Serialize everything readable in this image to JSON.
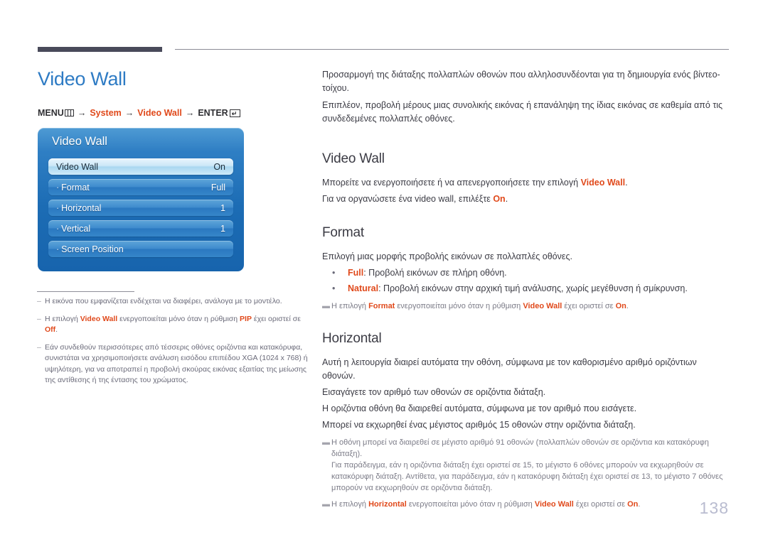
{
  "header": {
    "page_title": "Video Wall",
    "menu_path": {
      "menu_label": "MENU",
      "menu_icon": "menu-bars-icon",
      "arrow": "→",
      "item1": "System",
      "item2": "Video Wall",
      "enter_label": "ENTER",
      "enter_icon": "enter-return-icon",
      "enter_glyph": "↵"
    }
  },
  "osd": {
    "title": "Video Wall",
    "rows": [
      {
        "bullet": "",
        "label": "Video Wall",
        "value": "On",
        "selected": true
      },
      {
        "bullet": "·",
        "label": "Format",
        "value": "Full",
        "selected": false
      },
      {
        "bullet": "·",
        "label": "Horizontal",
        "value": "1",
        "selected": false
      },
      {
        "bullet": "·",
        "label": "Vertical",
        "value": "1",
        "selected": false
      },
      {
        "bullet": "·",
        "label": "Screen Position",
        "value": "",
        "selected": false
      }
    ]
  },
  "left_notes": [
    {
      "dash": "–",
      "parts": [
        {
          "t": "Η εικόνα που εμφανίζεται ενδέχεται να διαφέρει, ανάλογα με το μοντέλο.",
          "hl": false
        }
      ]
    },
    {
      "dash": "–",
      "parts": [
        {
          "t": "Η επιλογή ",
          "hl": false
        },
        {
          "t": "Video Wall",
          "hl": true
        },
        {
          "t": " ενεργοποιείται μόνο όταν η ρύθμιση ",
          "hl": false
        },
        {
          "t": "PIP",
          "hl": true
        },
        {
          "t": " έχει οριστεί σε ",
          "hl": false
        },
        {
          "t": "Off",
          "hl": true
        },
        {
          "t": ".",
          "hl": false
        }
      ]
    },
    {
      "dash": "–",
      "parts": [
        {
          "t": "Εάν συνδεθούν περισσότερες από τέσσερις οθόνες οριζόντια και κατακόρυφα, συνιστάται να χρησιμοποιήσετε ανάλυση εισόδου επιπέδου XGA (1024 x 768) ή υψηλότερη, για να αποτραπεί η προβολή σκούρας εικόνας εξαιτίας της μείωσης της αντίθεσης ή της έντασης του χρώματος.",
          "hl": false
        }
      ]
    }
  ],
  "main": {
    "intro": [
      "Προσαρμογή της διάταξης πολλαπλών οθονών που αλληλοσυνδέονται για τη δημιουργία ενός βίντεο-τοίχου.",
      "Επιπλέον, προβολή μέρους μιας συνολικής εικόνας ή επανάληψη της ίδιας εικόνας σε καθεμία από τις συνδεδεμένες πολλαπλές οθόνες."
    ],
    "sections": [
      {
        "heading": "Video Wall",
        "paragraphs": [
          [
            {
              "t": "Μπορείτε να ενεργοποιήσετε ή να απενεργοποιήσετε την επιλογή ",
              "hl": false
            },
            {
              "t": "Video Wall",
              "hl": true
            },
            {
              "t": ".",
              "hl": false
            }
          ],
          [
            {
              "t": "Για να οργανώσετε ένα video wall, επιλέξτε ",
              "hl": false
            },
            {
              "t": "On",
              "hl": true
            },
            {
              "t": ".",
              "hl": false
            }
          ]
        ],
        "bullets": [],
        "notes": []
      },
      {
        "heading": "Format",
        "paragraphs": [
          [
            {
              "t": "Επιλογή μιας μορφής προβολής εικόνων σε πολλαπλές οθόνες.",
              "hl": false
            }
          ]
        ],
        "bullets": [
          {
            "mark": "•",
            "parts": [
              {
                "t": "Full",
                "hl": true
              },
              {
                "t": ": Προβολή εικόνων σε πλήρη οθόνη.",
                "hl": false
              }
            ]
          },
          {
            "mark": "•",
            "parts": [
              {
                "t": "Natural",
                "hl": true
              },
              {
                "t": ": Προβολή εικόνων στην αρχική τιμή ανάλυσης, χωρίς μεγέθυνση ή σμίκρυνση.",
                "hl": false
              }
            ]
          }
        ],
        "notes": [
          {
            "dash": "▬",
            "parts": [
              {
                "t": "Η επιλογή ",
                "hl": false
              },
              {
                "t": "Format",
                "hl": true
              },
              {
                "t": " ενεργοποιείται μόνο όταν η ρύθμιση ",
                "hl": false
              },
              {
                "t": "Video Wall",
                "hl": true
              },
              {
                "t": " έχει οριστεί σε ",
                "hl": false
              },
              {
                "t": "On",
                "hl": true
              },
              {
                "t": ".",
                "hl": false
              }
            ]
          }
        ]
      },
      {
        "heading": "Horizontal",
        "paragraphs": [
          [
            {
              "t": "Αυτή η λειτουργία διαιρεί αυτόματα την οθόνη, σύμφωνα με τον καθορισμένο αριθμό οριζόντιων οθονών.",
              "hl": false
            }
          ],
          [
            {
              "t": "Εισαγάγετε τον αριθμό των οθονών σε οριζόντια διάταξη.",
              "hl": false
            }
          ],
          [
            {
              "t": "Η οριζόντια οθόνη θα διαιρεθεί αυτόματα, σύμφωνα με τον αριθμό που εισάγετε.",
              "hl": false
            }
          ],
          [
            {
              "t": "Μπορεί να εκχωρηθεί ένας μέγιστος αριθμός 15 οθονών στην οριζόντια διάταξη.",
              "hl": false
            }
          ]
        ],
        "bullets": [],
        "notes": [
          {
            "dash": "▬",
            "parts": [
              {
                "t": "Η οθόνη μπορεί να διαιρεθεί σε μέγιστο αριθμό 91 οθονών (πολλαπλών οθονών σε οριζόντια και κατακόρυφη διάταξη).",
                "hl": false
              },
              {
                "t": "\nΓια παράδειγμα, εάν η οριζόντια διάταξη έχει οριστεί σε 15, το μέγιστο 6 οθόνες μπορούν να εκχωρηθούν σε κατακόρυφη διάταξη. Αντίθετα, για παράδειγμα, εάν η κατακόρυφη διάταξη έχει οριστεί σε 13, το μέγιστο 7 οθόνες μπορούν να εκχωρηθούν σε οριζόντια διάταξη.",
                "hl": false
              }
            ]
          },
          {
            "dash": "▬",
            "parts": [
              {
                "t": "Η επιλογή ",
                "hl": false
              },
              {
                "t": "Horizontal",
                "hl": true
              },
              {
                "t": " ενεργοποιείται μόνο όταν η ρύθμιση ",
                "hl": false
              },
              {
                "t": "Video Wall",
                "hl": true
              },
              {
                "t": " έχει οριστεί σε ",
                "hl": false
              },
              {
                "t": "On",
                "hl": true
              },
              {
                "t": ".",
                "hl": false
              }
            ]
          }
        ]
      }
    ]
  },
  "footer": {
    "page_number": "138"
  }
}
